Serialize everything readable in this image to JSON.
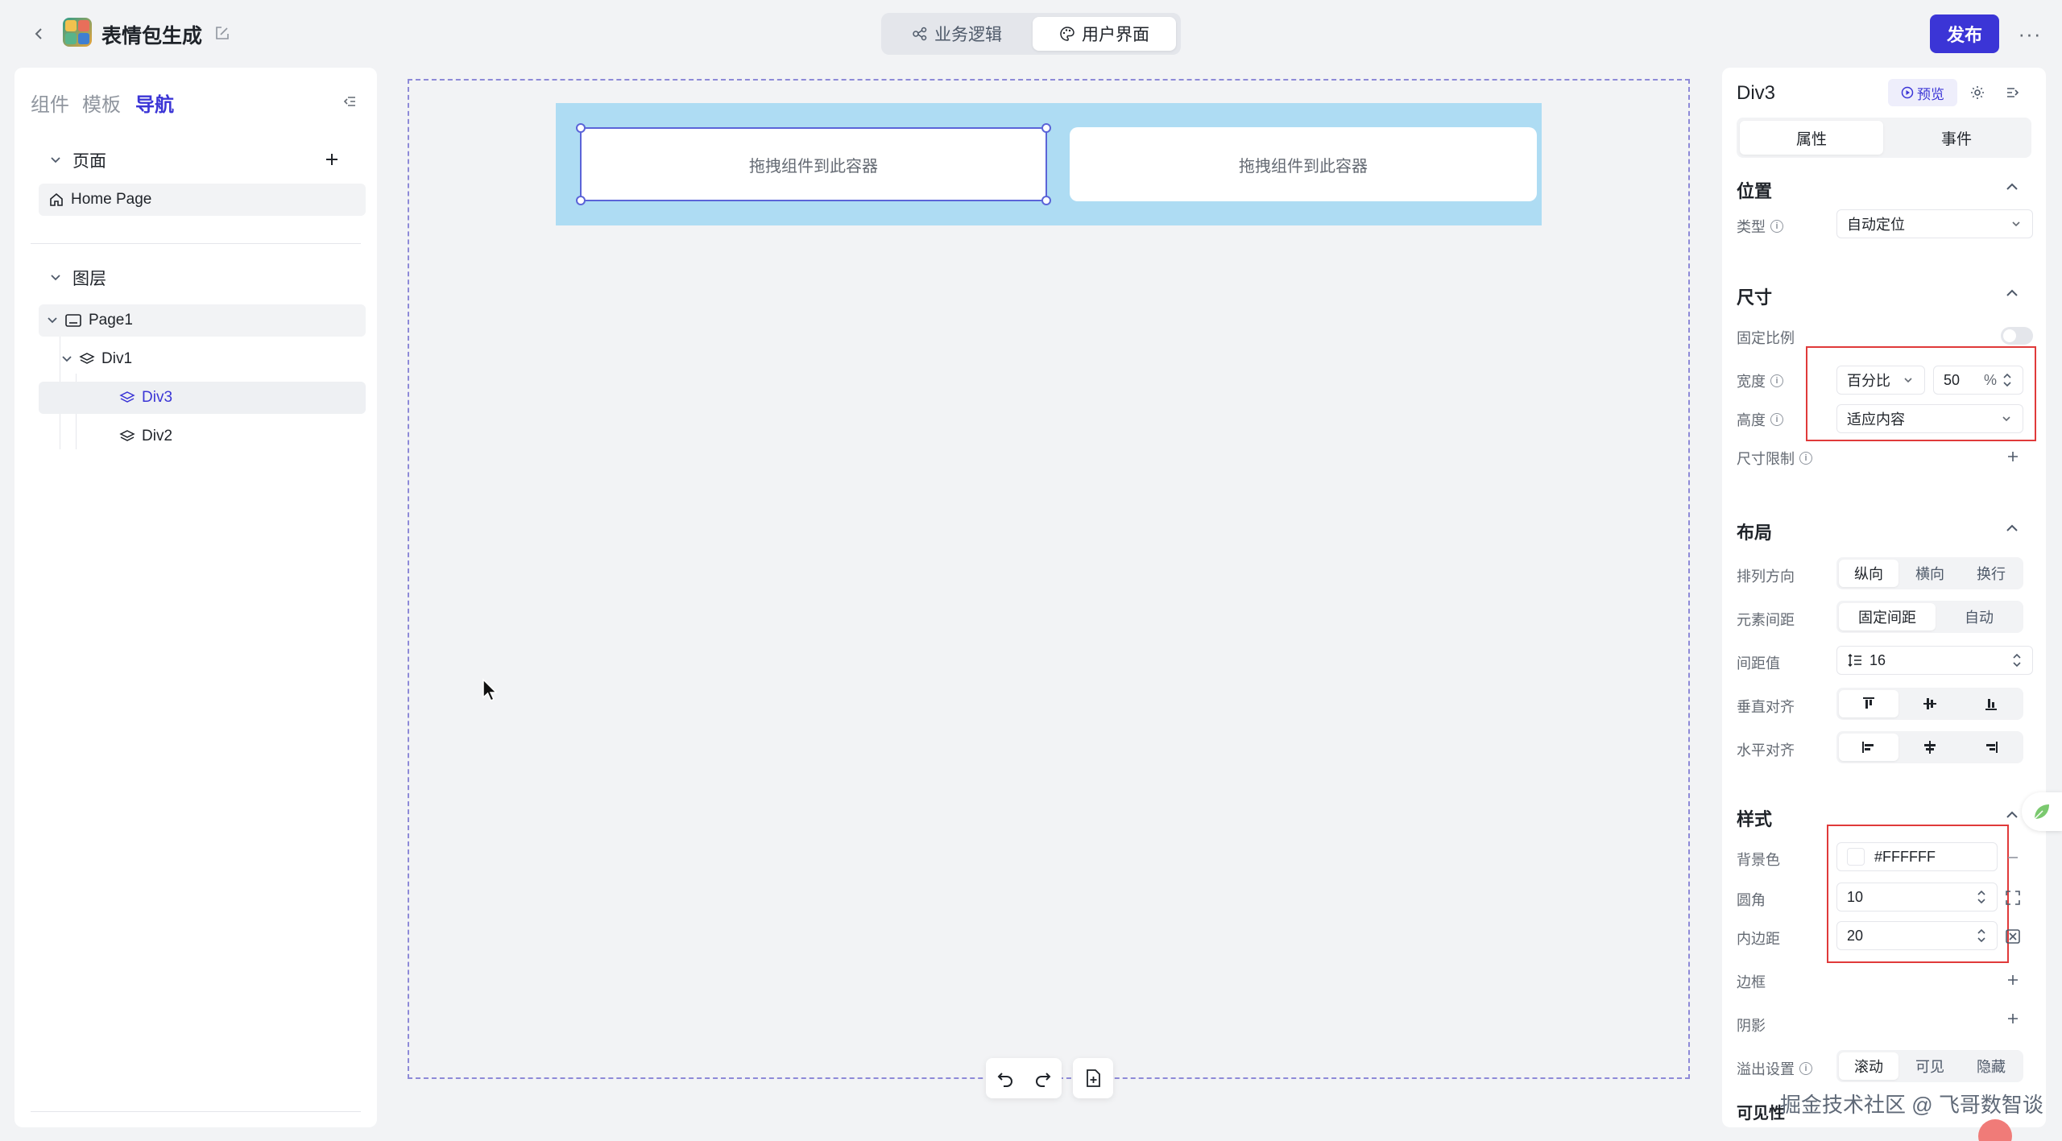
{
  "header": {
    "app_title": "表情包生成",
    "mode_tabs": [
      {
        "label": "业务逻辑",
        "icon": "flow-icon"
      },
      {
        "label": "用户界面",
        "icon": "palette-icon"
      }
    ],
    "publish_label": "发布",
    "more_label": "···"
  },
  "left_panel": {
    "tabs": [
      "组件",
      "模板",
      "导航"
    ],
    "active_tab": "导航",
    "pages_section": {
      "title": "页面",
      "items": [
        "Home Page"
      ]
    },
    "layers_section": {
      "title": "图层",
      "items": [
        "Page1",
        "Div1",
        "Div3",
        "Div2"
      ]
    }
  },
  "canvas": {
    "drop_placeholder_left": "拖拽组件到此容器",
    "drop_placeholder_right": "拖拽组件到此容器",
    "colors": {
      "container_bg": "#aedcf3",
      "selection": "#5b64d8",
      "page_border": "#8e8ad8"
    }
  },
  "right_panel": {
    "title": "Div3",
    "preview_label": "预览",
    "tabs": [
      "属性",
      "事件"
    ],
    "position": {
      "title": "位置",
      "type_label": "类型",
      "type_value": "自动定位"
    },
    "size": {
      "title": "尺寸",
      "lock_ratio_label": "固定比例",
      "width_label": "宽度",
      "width_unit_select": "百分比",
      "width_value": "50",
      "width_unit": "%",
      "height_label": "高度",
      "height_value": "适应内容",
      "limit_label": "尺寸限制"
    },
    "layout": {
      "title": "布局",
      "direction_label": "排列方向",
      "direction_options": [
        "纵向",
        "横向",
        "换行"
      ],
      "spacing_label": "元素间距",
      "spacing_options": [
        "固定间距",
        "自动"
      ],
      "gap_label": "间距值",
      "gap_value": "16",
      "valign_label": "垂直对齐",
      "halign_label": "水平对齐"
    },
    "style": {
      "title": "样式",
      "bg_label": "背景色",
      "bg_value": "#FFFFFF",
      "radius_label": "圆角",
      "radius_value": "10",
      "padding_label": "内边距",
      "padding_value": "20",
      "border_label": "边框",
      "shadow_label": "阴影",
      "overflow_label": "溢出设置",
      "overflow_options": [
        "滚动",
        "可见",
        "隐藏"
      ],
      "visibility_label": "可见性"
    },
    "accent_color": "#3b35d6"
  },
  "watermark": "掘金技术社区 @ 飞哥数智谈"
}
